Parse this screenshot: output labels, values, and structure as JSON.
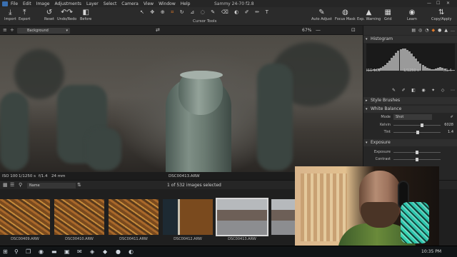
{
  "window": {
    "title": "Sammy 24-70 f2.8"
  },
  "menu": [
    "File",
    "Edit",
    "Image",
    "Adjustments",
    "Layer",
    "Select",
    "Camera",
    "View",
    "Window",
    "Help"
  ],
  "toolbar": {
    "left": [
      {
        "label": "Import",
        "icon": "import-icon",
        "glyph": "⤓"
      },
      {
        "label": "Export",
        "icon": "export-icon",
        "glyph": "⤒"
      },
      {
        "label": "Reset",
        "icon": "reset-icon",
        "glyph": "↺"
      },
      {
        "label": "Undo/Redo",
        "icon": "undo-icon",
        "glyph": "↶↷"
      },
      {
        "label": "Before",
        "icon": "before-icon",
        "glyph": "◧"
      }
    ],
    "cursor_tools_label": "Cursor Tools",
    "right": [
      {
        "label": "Auto Adjust",
        "icon": "auto-adjust-icon",
        "glyph": "✎"
      },
      {
        "label": "Focus Mask",
        "icon": "focus-mask-icon",
        "glyph": "◍"
      },
      {
        "label": "Exp. Warning",
        "icon": "exposure-warning-icon",
        "glyph": "▲"
      },
      {
        "label": "Grid",
        "icon": "grid-icon",
        "glyph": "▦"
      },
      {
        "label": "Learn",
        "icon": "learn-icon",
        "glyph": "◉"
      },
      {
        "label": "Copy/Apply",
        "icon": "copy-apply-icon",
        "glyph": "⇅"
      }
    ]
  },
  "viewer": {
    "variant": "Background",
    "zoom": "67%",
    "iso": "ISO 100",
    "shutter": "1/1250 s",
    "aperture": "f/1.4",
    "focal": "24 mm",
    "filename": "DSC00413.ARW"
  },
  "browser": {
    "sort": "Name",
    "count_text": "1 of 532 images selected",
    "thumbnails": [
      {
        "name": "DSC00409.ARW",
        "kind": "leaves",
        "selected": false
      },
      {
        "name": "DSC00410.ARW",
        "kind": "leaves",
        "selected": false
      },
      {
        "name": "DSC00411.ARW",
        "kind": "leaves",
        "selected": false
      },
      {
        "name": "DSC00412.ARW",
        "kind": "split",
        "selected": false
      },
      {
        "name": "DSC00413.ARW",
        "kind": "street",
        "selected": true
      },
      {
        "name": "",
        "kind": "street",
        "selected": false
      }
    ]
  },
  "panel": {
    "histogram": {
      "title": "Histogram",
      "iso": "ISO 100",
      "shutter": "1/1250 s",
      "aperture": "f/1.4"
    },
    "style_brushes": "Style Brushes",
    "white_balance": {
      "title": "White Balance",
      "mode_label": "Mode",
      "mode_value": "Shot",
      "kelvin_label": "Kelvin",
      "kelvin_value": "6028",
      "kelvin_level": 0.62,
      "tint_label": "Tint",
      "tint_value": "1.4",
      "tint_level": 0.52
    },
    "exposure": {
      "title": "Exposure",
      "exposure_label": "Exposure",
      "contrast_label": "Contrast",
      "exposure_level": 0.5,
      "contrast_level": 0.5
    }
  },
  "taskbar": {
    "time": "10:35 PM"
  },
  "colors": {
    "accent": "#e07a2a",
    "panel_bg": "#262626"
  }
}
